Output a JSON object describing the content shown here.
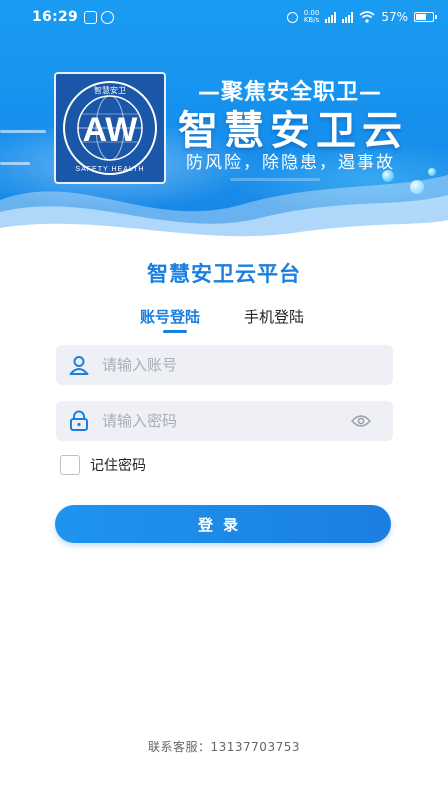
{
  "status_bar": {
    "time": "16:29",
    "net_speed_value": "0.00",
    "net_speed_unit": "KB/s",
    "battery": "57%"
  },
  "banner": {
    "slogan": "—聚焦安全职卫—",
    "title": "智慧安卫云",
    "tagline": "防风险，除隐患，遏事故",
    "logo_top_text": "智慧安卫",
    "logo_bottom_text": "SAFETY HEALTH",
    "logo_letters": "AW"
  },
  "login": {
    "platform_title": "智慧安卫云平台",
    "tabs": [
      {
        "label": "账号登陆",
        "active": true
      },
      {
        "label": "手机登陆",
        "active": false
      }
    ],
    "account_placeholder": "请输入账号",
    "password_placeholder": "请输入密码",
    "remember_label": "记住密码",
    "remember_checked": false,
    "login_button": "登录",
    "contact": "联系客服：13137703753"
  },
  "colors": {
    "accent": "#1b7fe0",
    "banner": "#1692ee",
    "input_bg": "#eef0f5"
  },
  "icons": {
    "account": "user-icon",
    "password": "lock-icon",
    "visibility": "eye-icon"
  }
}
